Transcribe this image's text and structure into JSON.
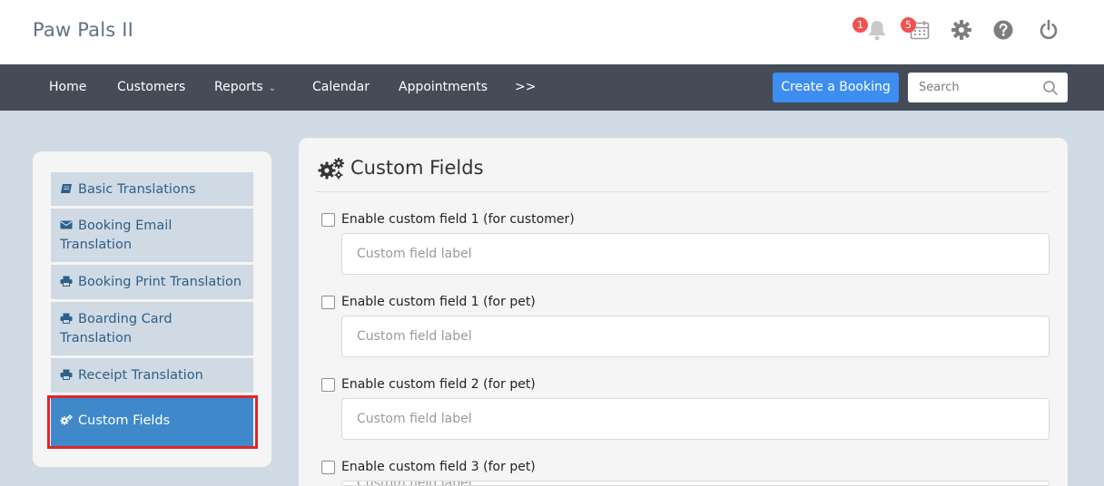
{
  "app": {
    "title": "Paw Pals II"
  },
  "header": {
    "notifications_count": "1",
    "calendar_count": "5",
    "icons": [
      "bell-icon",
      "calendar-icon",
      "gear-icon",
      "help-icon",
      "power-icon"
    ]
  },
  "nav": {
    "home": "Home",
    "customers": "Customers",
    "reports": "Reports",
    "calendar": "Calendar",
    "appointments": "Appointments",
    "more": ">>",
    "create_booking": "Create a Booking",
    "search_placeholder": "Search"
  },
  "sidebar": {
    "items": [
      {
        "label": "Basic Translations",
        "icon": "book-icon"
      },
      {
        "label": "Booking Email Translation",
        "icon": "envelope-icon"
      },
      {
        "label": "Booking Print Translation",
        "icon": "print-icon"
      },
      {
        "label": "Boarding Card Translation",
        "icon": "print-icon"
      },
      {
        "label": "Receipt Translation",
        "icon": "print-icon"
      },
      {
        "label": "Custom Fields",
        "icon": "gears-icon",
        "active": true
      }
    ]
  },
  "main": {
    "title": "Custom Fields",
    "fields": [
      {
        "label": "Enable custom field 1 (for customer)",
        "placeholder": "Custom field label",
        "checked": false
      },
      {
        "label": "Enable custom field 1 (for pet)",
        "placeholder": "Custom field label",
        "checked": false
      },
      {
        "label": "Enable custom field 2 (for pet)",
        "placeholder": "Custom field label",
        "checked": false
      },
      {
        "label": "Enable custom field 3 (for pet)",
        "placeholder": "Custom field label",
        "checked": false
      }
    ]
  },
  "colors": {
    "navbar": "#454c58",
    "accent": "#3d8ef0",
    "active_item": "#3f88c9",
    "highlight_border": "#e3242b",
    "badge": "#ef5350"
  }
}
